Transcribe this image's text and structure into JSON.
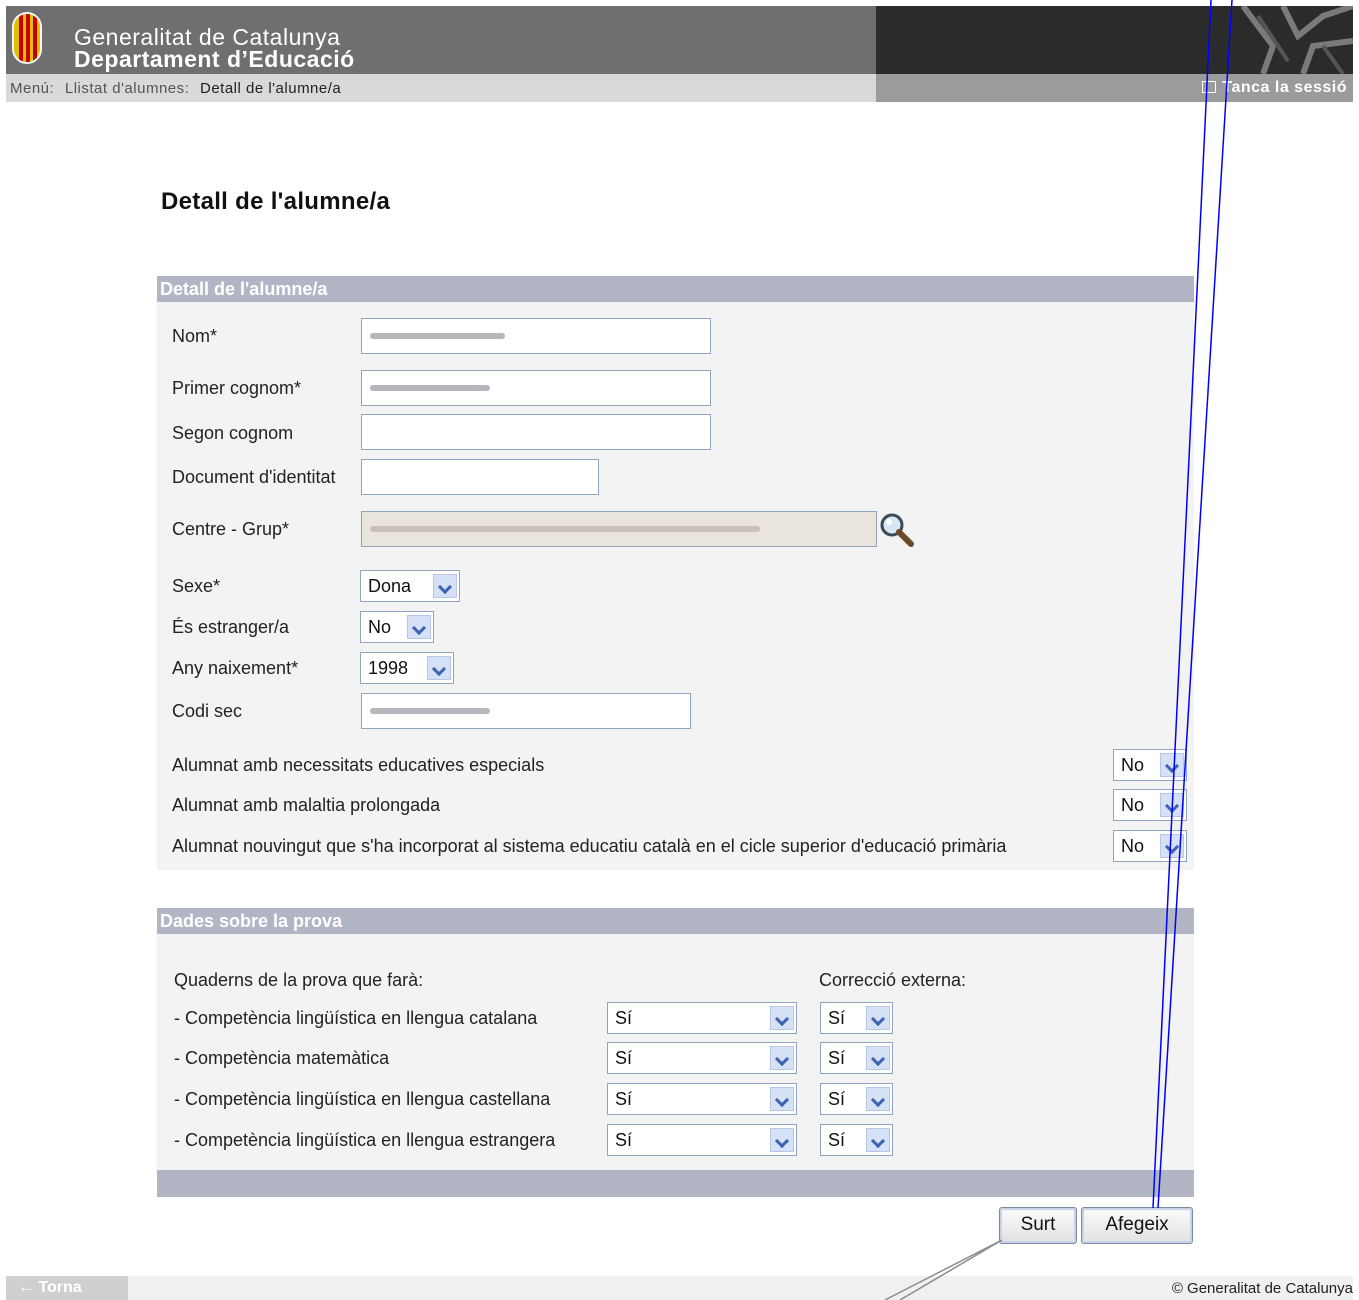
{
  "header": {
    "org_line1": "Generalitat de Catalunya",
    "org_line2": "Departament d’Educació",
    "breadcrumb": [
      "Menú:",
      "Llistat d'alumnes:",
      "Detall de l'alumne/a"
    ],
    "logout_label": "Tanca la sessió"
  },
  "page_title": "Detall de l'alumne/a",
  "student_panel": {
    "heading": "Detall de l'alumne/a",
    "fields": {
      "nom_label": "Nom*",
      "primer_cognom_label": "Primer cognom*",
      "segon_cognom_label": "Segon cognom",
      "document_label": "Document d'identitat",
      "centre_label": "Centre - Grup*",
      "sexe_label": "Sexe*",
      "sexe_value": "Dona",
      "estranger_label": "És estranger/a",
      "estranger_value": "No",
      "any_label": "Any naixement*",
      "any_value": "1998",
      "codi_label": "Codi sec",
      "nee_label": "Alumnat amb necessitats educatives especials",
      "nee_value": "No",
      "malaltia_label": "Alumnat amb malaltia prolongada",
      "malaltia_value": "No",
      "nouvingut_label": "Alumnat nouvingut que s'ha incorporat al sistema educatiu català en el cicle superior d'educació primària",
      "nouvingut_value": "No"
    }
  },
  "exam_panel": {
    "heading": "Dades sobre la prova",
    "quaderns_label": "Quaderns de la prova que farà:",
    "correccio_label": "Correcció externa:",
    "rows": [
      {
        "label": "- Competència lingüística en llengua catalana",
        "value": "Sí",
        "correccio": "Sí"
      },
      {
        "label": "- Competència matemàtica",
        "value": "Sí",
        "correccio": "Sí"
      },
      {
        "label": "- Competència lingüística en llengua castellana",
        "value": "Sí",
        "correccio": "Sí"
      },
      {
        "label": "- Competència lingüística en llengua estrangera",
        "value": "Sí",
        "correccio": "Sí"
      }
    ]
  },
  "buttons": {
    "surt": "Surt",
    "afegeix": "Afegeix"
  },
  "footer": {
    "back": "← Torna",
    "copyright": "© Generalitat de Catalunya"
  },
  "colors": {
    "panel_header": "#b2b6c4",
    "header_bg": "#6f6f6f",
    "annotation_line": "#0000ff"
  }
}
